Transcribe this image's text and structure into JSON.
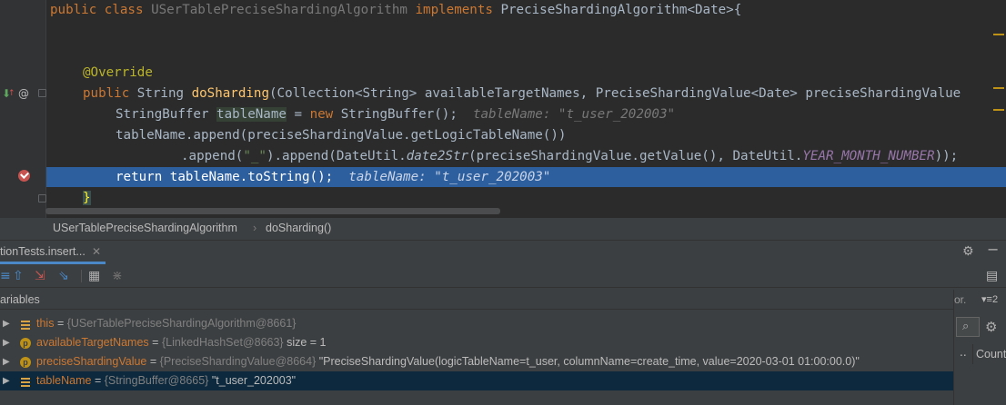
{
  "editor": {
    "lines": {
      "class_decl": {
        "kw_public": "public",
        "kw_class": "class",
        "class_name": "USerTablePreciseShardingAlgorithm",
        "kw_implements": "implements",
        "interface": "PreciseShardingAlgorithm<Date>{"
      },
      "annotation": "@Override",
      "method_decl": {
        "kw_public": "public",
        "ret": "String",
        "method": "doSharding",
        "params": "(Collection<String> availableTargetNames, PreciseShardingValue<Date> preciseShardingValue"
      },
      "line_buffer": {
        "type": "StringBuffer",
        "var": "tableName",
        "eq": "=",
        "kw_new": "new",
        "ctor": "StringBuffer();",
        "hint": "tableName: \"t_user_202003\""
      },
      "line_append1": "tableName.append(preciseShardingValue.getLogicTableName())",
      "line_append2": {
        "pre": ".append(",
        "str": "\"_\"",
        "mid": ").append(DateUtil.",
        "call": "date2Str",
        "args": "(preciseShardingValue.getValue(), DateUtil.",
        "const": "YEAR_MONTH_NUMBER",
        "end": "));"
      },
      "line_return": {
        "kw_return": "return",
        "expr": "tableName.toString();",
        "hint": "tableName: \"t_user_202003\""
      },
      "closing_brace": "}"
    }
  },
  "breadcrumb": {
    "class": "USerTablePreciseShardingAlgorithm",
    "separator": "›",
    "method": "doSharding()"
  },
  "debug": {
    "session_tab": "tionTests.insert...",
    "variables_header": "ariables",
    "variables": [
      {
        "name": "this",
        "eq": "=",
        "type": "{USerTablePreciseShardingAlgorithm@8661}",
        "value": "",
        "icon": "field-icon"
      },
      {
        "name": "availableTargetNames",
        "eq": "=",
        "type": "{LinkedHashSet@8663}",
        "value": "size = 1",
        "icon": "param-icon"
      },
      {
        "name": "preciseShardingValue",
        "eq": "=",
        "type": "{PreciseShardingValue@8664}",
        "value": "\"PreciseShardingValue(logicTableName=t_user, columnName=create_time, value=2020-03-01 01:00:00.0)\"",
        "icon": "param-icon"
      },
      {
        "name": "tableName",
        "eq": "=",
        "type": "{StringBuffer@8665}",
        "value": "\"t_user_202003\"",
        "icon": "field-icon"
      }
    ],
    "side": {
      "label": "or.",
      "sort": "▾≡2",
      "dots": "..",
      "count": "Count"
    }
  },
  "colors": {
    "execution_line": "#2d5f9f",
    "breakpoint": "#c75450",
    "keyword": "#cc7832",
    "string": "#6a8759"
  }
}
